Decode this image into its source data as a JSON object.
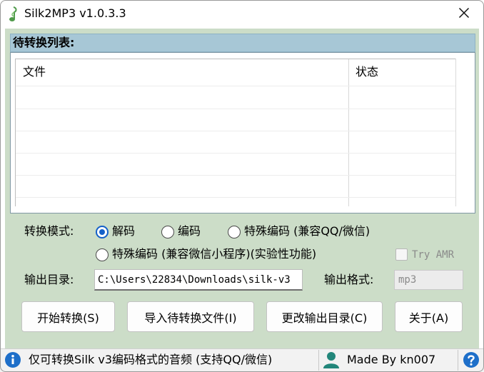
{
  "window": {
    "title": "Silk2MP3 v1.0.3.3"
  },
  "list": {
    "header_label": "待转换列表:",
    "columns": [
      "文件",
      "状态"
    ]
  },
  "mode": {
    "label": "转换模式:",
    "options": [
      "解码",
      "编码",
      "特殊编码 (兼容QQ/微信)",
      "特殊编码 (兼容微信小程序)(实验性功能)"
    ],
    "selected": "解码"
  },
  "try_amr": {
    "label": "Try AMR",
    "checked": false,
    "enabled": false
  },
  "output": {
    "dir_label": "输出目录:",
    "dir_value": "C:\\Users\\22834\\Downloads\\silk-v3",
    "format_label": "输出格式:",
    "format_value": "mp3"
  },
  "buttons": {
    "start": "开始转换(S)",
    "import": "导入待转换文件(I)",
    "change_dir": "更改输出目录(C)",
    "about": "关于(A)"
  },
  "status": {
    "info_text": "仅可转换Silk v3编码格式的音频 (支持QQ/微信)",
    "author_text": "Made By kn007"
  },
  "colors": {
    "client_bg": "#ccddc8",
    "list_header_bg": "#a7c7d6",
    "radio_accent": "#1560c9",
    "status_icon_blue": "#1e6fc9",
    "person_icon_teal": "#22867a"
  },
  "icons": {
    "app": "music-note-icon",
    "close": "close-icon",
    "info": "info-icon",
    "person": "person-icon",
    "help": "help-icon"
  }
}
